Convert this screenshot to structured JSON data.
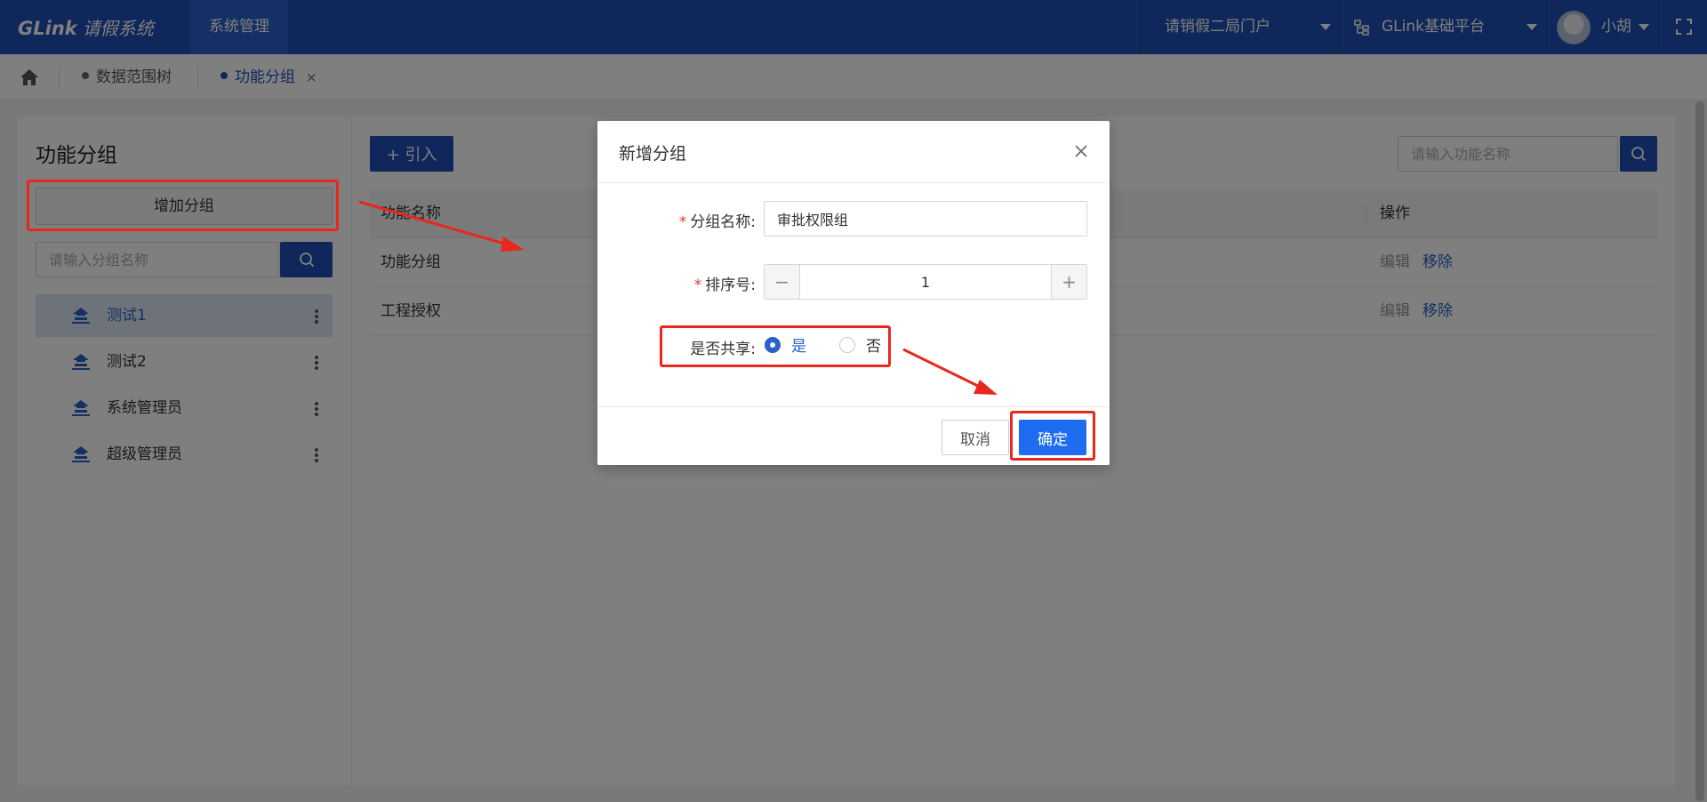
{
  "topbar": {
    "logo_brand": "GLink",
    "logo_app": "请假系统",
    "nav_active": "系统管理",
    "portal_select": "请销假二局门户",
    "platform_select": "GLink基础平台",
    "user_name": "小胡"
  },
  "tabs": [
    {
      "label": "数据范围树"
    },
    {
      "label": "功能分组",
      "close": "×"
    }
  ],
  "left_panel": {
    "title": "功能分组",
    "add_button": "增加分组",
    "search_placeholder": "请输入分组名称",
    "tree": [
      {
        "label": "测试1",
        "selected": true
      },
      {
        "label": "测试2",
        "selected": false
      },
      {
        "label": "系统管理员",
        "selected": false
      },
      {
        "label": "超级管理员",
        "selected": false
      }
    ]
  },
  "right_panel": {
    "import_button": "+ 引入",
    "search_placeholder": "请输入功能名称",
    "columns": {
      "name": "功能名称",
      "actions": "操作"
    },
    "rows": [
      {
        "name": "功能分组",
        "edit": "编辑",
        "remove": "移除"
      },
      {
        "name": "工程授权",
        "edit": "编辑",
        "remove": "移除"
      }
    ]
  },
  "modal": {
    "title": "新增分组",
    "close": "×",
    "group_name_label": "分组名称:",
    "group_name_value": "审批权限组",
    "sort_label": "排序号:",
    "sort_value": "1",
    "minus": "−",
    "plus": "+",
    "share_label": "是否共享:",
    "share_yes": "是",
    "share_no": "否",
    "share_selected": "是",
    "cancel_button": "取消",
    "ok_button": "确定"
  },
  "colors": {
    "primary": "#1f4eb4",
    "accent": "#1f6cf0",
    "annotation": "#e8271f"
  }
}
